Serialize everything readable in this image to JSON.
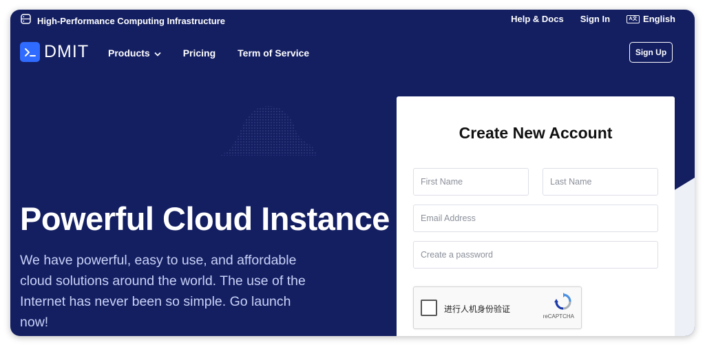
{
  "topbar": {
    "tagline": "High-Performance Computing Infrastructure",
    "help": "Help & Docs",
    "signin": "Sign In",
    "language": "English"
  },
  "nav": {
    "logo": "DMIT",
    "products": "Products",
    "pricing": "Pricing",
    "tos": "Term of Service",
    "signup": "Sign Up"
  },
  "hero": {
    "title": "Powerful Cloud Instance",
    "subtitle": "We have powerful, easy to use, and affordable cloud solutions around the world. The use of the Internet has never been so simple. Go launch now!"
  },
  "form": {
    "title": "Create New Account",
    "first_name_placeholder": "First Name",
    "last_name_placeholder": "Last Name",
    "email_placeholder": "Email Address",
    "password_placeholder": "Create a password",
    "captcha_label": "进行人机身份验证",
    "captcha_brand": "reCAPTCHA"
  },
  "colors": {
    "background": "#141f62",
    "accent": "#2f6bff",
    "card": "#ffffff"
  },
  "icons": [
    "server-icon",
    "translate-icon",
    "terminal-logo-icon",
    "chevron-down-icon",
    "recaptcha-icon"
  ]
}
